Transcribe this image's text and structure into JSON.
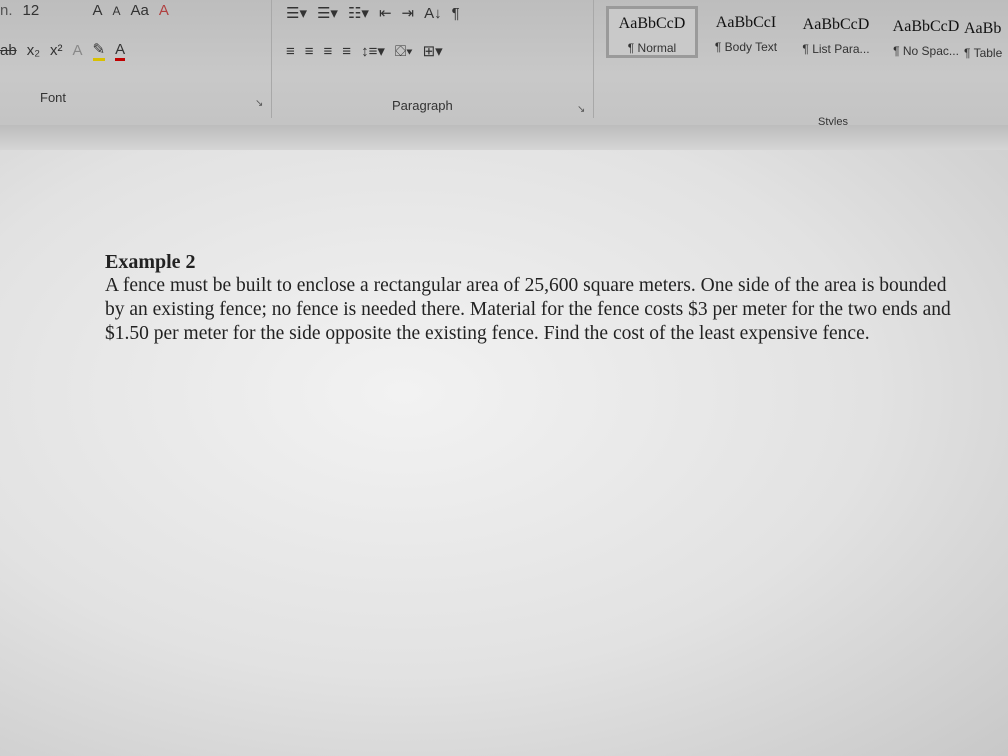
{
  "ribbon": {
    "font": {
      "label": "Font",
      "font_name_partial": "n.",
      "font_size": "12",
      "grow": "A",
      "shrink": "A",
      "change_case": "Aa",
      "clear_format": "A",
      "strike": "ab",
      "subscript": "x₂",
      "superscript": "x²",
      "text_effects": "A",
      "highlight": "✎",
      "font_color": "A"
    },
    "paragraph": {
      "label": "Paragraph",
      "pilcrow": "¶",
      "sort": "A↓"
    },
    "styles": {
      "label": "Styles",
      "items": [
        {
          "preview": "AaBbCcD",
          "name": "¶ Normal",
          "selected": true
        },
        {
          "preview": "AaBbCcI",
          "name": "¶ Body Text"
        },
        {
          "preview": "AaBbCcD",
          "name": "¶ List Para..."
        },
        {
          "preview": "AaBbCcD",
          "name": "¶ No Spac..."
        },
        {
          "preview": "AaBb",
          "name": "¶ Table"
        }
      ]
    }
  },
  "document": {
    "heading": "Example 2",
    "body": "A fence must be built to enclose a rectangular area of 25,600 square meters. One side of the area is bounded by an existing fence; no fence is needed there. Material for the fence costs $3 per meter for the two ends and $1.50 per meter for the side opposite the existing fence. Find the cost of the least expensive fence."
  }
}
